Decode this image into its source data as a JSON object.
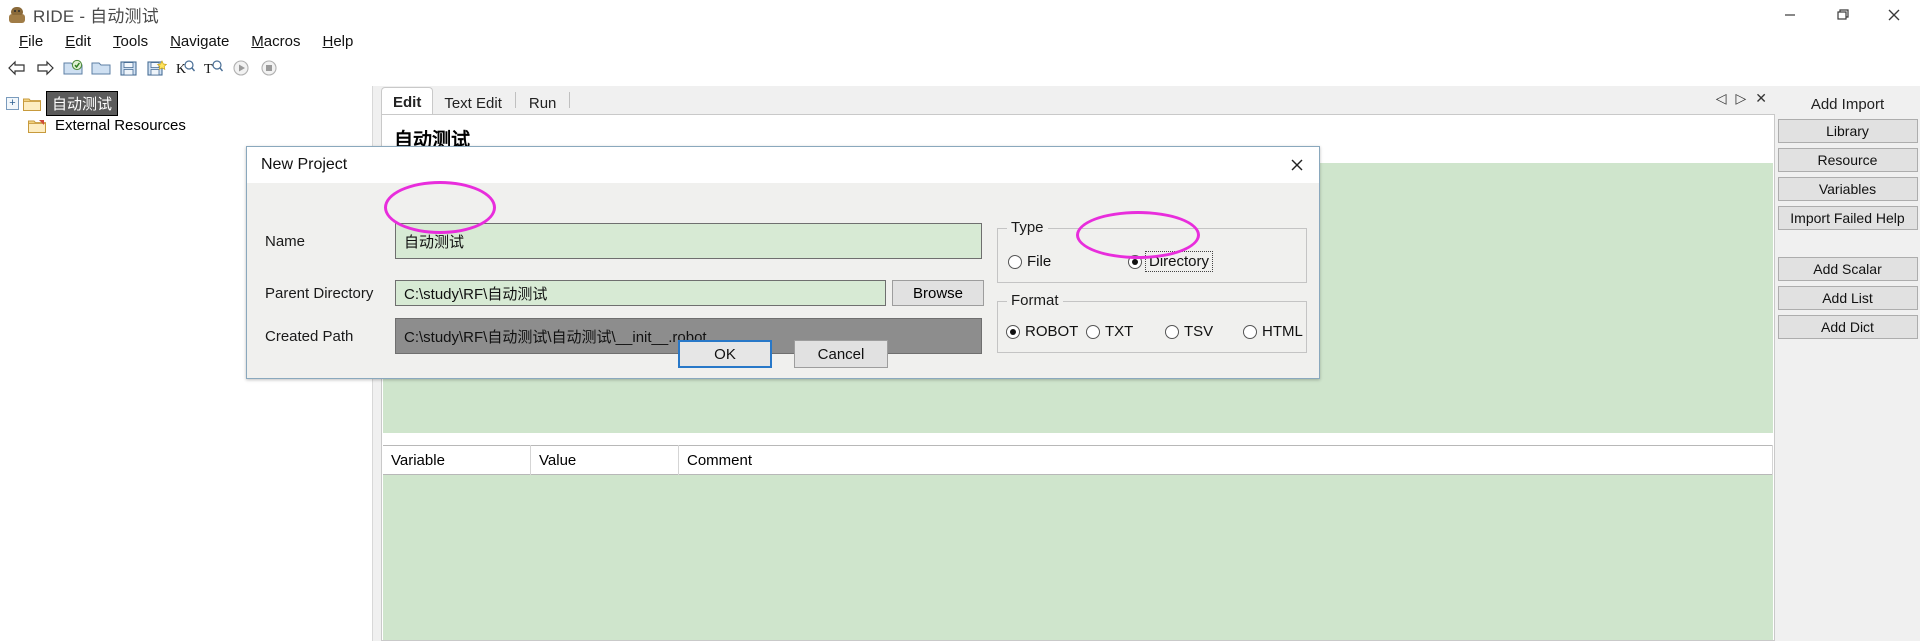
{
  "window": {
    "title": "RIDE - 自动测试",
    "icon": "robot-icon",
    "minimize_label": "minimize-icon",
    "maximize_label": "maximize-icon",
    "close_label": "close-icon"
  },
  "menubar": {
    "items": [
      {
        "label": "File",
        "mnemonic": "F"
      },
      {
        "label": "Edit",
        "mnemonic": "E"
      },
      {
        "label": "Tools",
        "mnemonic": "T"
      },
      {
        "label": "Navigate",
        "mnemonic": "N"
      },
      {
        "label": "Macros",
        "mnemonic": "M"
      },
      {
        "label": "Help",
        "mnemonic": "H"
      }
    ]
  },
  "toolbar": {
    "items": [
      {
        "name": "back-icon",
        "tooltip": "Back"
      },
      {
        "name": "forward-icon",
        "tooltip": "Forward"
      },
      {
        "name": "open-project-icon",
        "tooltip": "Open Directory"
      },
      {
        "name": "open-folder-icon",
        "tooltip": "Open"
      },
      {
        "name": "save-icon",
        "tooltip": "Save"
      },
      {
        "name": "save-all-icon",
        "tooltip": "Save All"
      },
      {
        "name": "search-keyword-icon",
        "tooltip": "Search Keywords"
      },
      {
        "name": "search-tests-icon",
        "tooltip": "Search Tests"
      },
      {
        "name": "run-icon",
        "tooltip": "Run"
      },
      {
        "name": "stop-icon",
        "tooltip": "Stop"
      }
    ]
  },
  "tree": {
    "items": [
      {
        "label": "自动测试",
        "icon": "folder-icon",
        "selected": true,
        "expander": "+"
      },
      {
        "label": "External Resources",
        "icon": "resource-folder-icon",
        "selected": false
      }
    ]
  },
  "editor": {
    "tabs": [
      {
        "label": "Edit",
        "active": true
      },
      {
        "label": "Text Edit",
        "active": false
      },
      {
        "label": "Run",
        "active": false
      }
    ],
    "tab_controls": [
      {
        "name": "scroll-left-icon",
        "glyph": "◁"
      },
      {
        "name": "scroll-right-icon",
        "glyph": "▷"
      },
      {
        "name": "close-tab-icon",
        "glyph": "✕"
      }
    ],
    "doc_title": "自动测试",
    "variables_table": {
      "columns": [
        "Variable",
        "Value",
        "Comment"
      ],
      "rows": []
    }
  },
  "side_buttons": {
    "import_group_label": "Add Import",
    "import_buttons": [
      "Library",
      "Resource",
      "Variables",
      "Import Failed Help"
    ],
    "variable_buttons": [
      "Add Scalar",
      "Add List",
      "Add Dict"
    ]
  },
  "dialog": {
    "title": "New Project",
    "close_label": "close-icon",
    "fields": {
      "name_label": "Name",
      "name_value": "自动测试",
      "parent_directory_label": "Parent Directory",
      "parent_directory_value": "C:\\study\\RF\\自动测试",
      "browse_label": "Browse",
      "created_path_label": "Created Path",
      "created_path_value": "C:\\study\\RF\\自动测试\\自动测试\\__init__.robot"
    },
    "type_group": {
      "label": "Type",
      "options": [
        {
          "label": "File",
          "selected": false
        },
        {
          "label": "Directory",
          "selected": true,
          "focused": true
        }
      ]
    },
    "format_group": {
      "label": "Format",
      "options": [
        {
          "label": "ROBOT",
          "selected": true
        },
        {
          "label": "TXT",
          "selected": false
        },
        {
          "label": "TSV",
          "selected": false
        },
        {
          "label": "HTML",
          "selected": false
        }
      ]
    },
    "buttons": {
      "ok": "OK",
      "cancel": "Cancel"
    }
  },
  "annotations": {
    "color": "#e82ddc",
    "marks": [
      {
        "name": "name-field-highlight",
        "target": "name_value"
      },
      {
        "name": "directory-radio-highlight",
        "target": "type.Directory"
      }
    ]
  }
}
